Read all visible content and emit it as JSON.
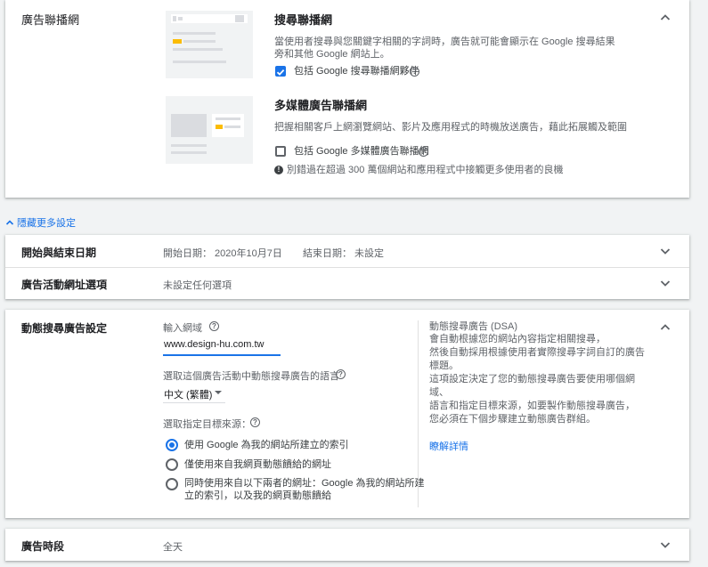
{
  "network": {
    "label": "廣告聯播網",
    "search": {
      "title": "搜尋聯播網",
      "desc": "當使用者搜尋與您關鍵字相關的字詞時，廣告就可能會顯示在 Google 搜尋結果旁和其他 Google 網站上。",
      "checkbox_label": "包括 Google 搜尋聯播網夥伴",
      "checked": true
    },
    "display": {
      "title": "多媒體廣告聯播網",
      "desc": "把握相關客戶上網瀏覽網站、影片及應用程式的時機放送廣告，藉此拓展觸及範圍",
      "checkbox_label": "包括 Google 多媒體廣告聯播網",
      "checked": false,
      "warning": "別錯過在超過 300 萬個網站和應用程式中接觸更多使用者的良機"
    }
  },
  "toggle_more": "隱藏更多設定",
  "dates": {
    "label": "開始與結束日期",
    "start": "開始日期： 2020年10月7日",
    "end": "結束日期： 未設定"
  },
  "url_options": {
    "label": "廣告活動網址選項",
    "value": "未設定任何選項"
  },
  "dsa": {
    "label": "動態搜尋廣告設定",
    "domain_label": "輸入網域",
    "domain_value": "www.design-hu.com.tw",
    "language_label": "選取這個廣告活動中動態搜尋廣告的語言",
    "language_value": "中文 (繁體)",
    "source_label": "選取指定目標來源：",
    "options": [
      {
        "text": "使用 Google 為我的網站所建立的索引",
        "selected": true
      },
      {
        "text": "僅使用來自我網頁動態饋給的網址",
        "selected": false
      },
      {
        "text_line1": "同時使用來自以下兩者的網址：Google 為我的網站所建",
        "text_line2": "立的索引，以及我的網頁動態饋給",
        "selected": false
      }
    ],
    "side_title": "動態搜尋廣告 (DSA)",
    "side_lines": [
      "會自動根據您的網站內容指定相關搜尋，",
      "然後自動採用根據使用者實際搜尋字詞自訂的廣告標題。",
      "這項設定決定了您的動態搜尋廣告要使用哪個網域、",
      "語言和指定目標來源，如要製作動態搜尋廣告，",
      "您必須在下個步驟建立動態廣告群組。"
    ],
    "learn_more": "瞭解詳情"
  },
  "schedule": {
    "label": "廣告時段",
    "value": "全天"
  },
  "colors": {
    "accent": "#1a73e8",
    "highlight": "#fbbc04"
  }
}
